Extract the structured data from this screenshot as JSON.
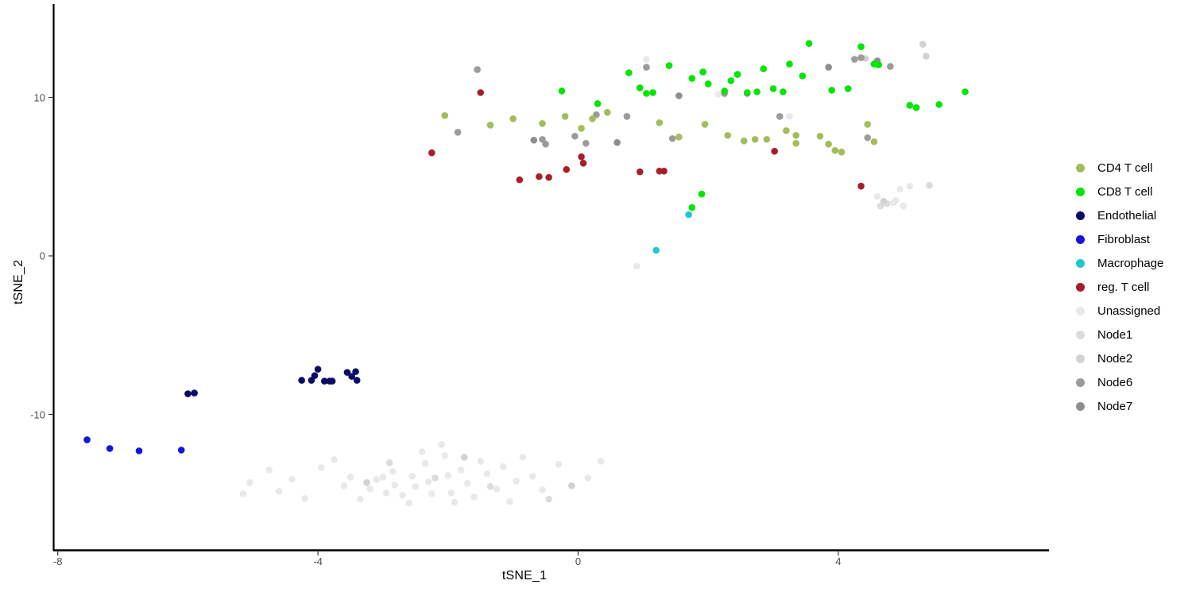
{
  "chart_data": {
    "type": "scatter",
    "title": "",
    "xlabel": "tSNE_1",
    "ylabel": "tSNE_2",
    "xlim": [
      -8.8,
      6.2
    ],
    "ylim": [
      -17.2,
      14.4
    ],
    "xticks": [
      -8,
      -4,
      0,
      4
    ],
    "xticklabels": [
      "-8",
      "-4",
      "0",
      "4"
    ],
    "yticks": [
      10,
      0,
      -10
    ],
    "yticklabels": [
      "10",
      "0",
      "-10"
    ],
    "grid": false,
    "legend_position": "right",
    "point_radius": 4.3,
    "series": [
      {
        "name": "CD4 T cell",
        "color": "#a3bd5a",
        "points": [
          [
            -2.05,
            8.85
          ],
          [
            -1.35,
            8.25
          ],
          [
            -1.0,
            8.65
          ],
          [
            -0.55,
            8.35
          ],
          [
            -0.2,
            8.8
          ],
          [
            0.05,
            8.05
          ],
          [
            0.22,
            8.65
          ],
          [
            0.45,
            9.05
          ],
          [
            1.25,
            8.4
          ],
          [
            1.55,
            7.5
          ],
          [
            1.95,
            8.3
          ],
          [
            2.3,
            7.6
          ],
          [
            2.55,
            7.25
          ],
          [
            2.72,
            7.35
          ],
          [
            2.9,
            7.35
          ],
          [
            3.2,
            7.9
          ],
          [
            3.35,
            7.6
          ],
          [
            3.35,
            7.1
          ],
          [
            3.72,
            7.55
          ],
          [
            3.85,
            7.05
          ],
          [
            3.95,
            6.65
          ],
          [
            4.05,
            6.55
          ],
          [
            4.45,
            8.3
          ],
          [
            4.55,
            7.2
          ]
        ]
      },
      {
        "name": "CD8 T cell",
        "color": "#00e600",
        "points": [
          [
            -0.25,
            10.4
          ],
          [
            0.3,
            9.6
          ],
          [
            0.78,
            11.55
          ],
          [
            0.95,
            10.6
          ],
          [
            1.05,
            10.25
          ],
          [
            1.4,
            12.0
          ],
          [
            1.75,
            11.2
          ],
          [
            1.92,
            11.6
          ],
          [
            2.0,
            10.85
          ],
          [
            2.25,
            10.4
          ],
          [
            2.35,
            11.05
          ],
          [
            2.45,
            11.45
          ],
          [
            2.6,
            10.3
          ],
          [
            2.85,
            11.8
          ],
          [
            3.0,
            10.55
          ],
          [
            3.15,
            10.35
          ],
          [
            3.45,
            11.35
          ],
          [
            3.55,
            13.4
          ],
          [
            3.9,
            10.45
          ],
          [
            4.15,
            10.55
          ],
          [
            4.35,
            13.2
          ],
          [
            4.55,
            12.1
          ],
          [
            4.62,
            12.05
          ],
          [
            5.1,
            9.5
          ],
          [
            5.2,
            9.35
          ],
          [
            5.55,
            9.55
          ],
          [
            5.95,
            10.35
          ],
          [
            1.9,
            3.9
          ],
          [
            1.75,
            3.05
          ],
          [
            2.75,
            10.35
          ],
          [
            3.25,
            12.1
          ],
          [
            1.15,
            10.3
          ]
        ]
      },
      {
        "name": "Endothelial",
        "color": "#0b0b66",
        "points": [
          [
            -6.0,
            -8.7
          ],
          [
            -5.9,
            -8.65
          ],
          [
            -4.25,
            -7.85
          ],
          [
            -4.1,
            -7.85
          ],
          [
            -4.0,
            -7.15
          ],
          [
            -4.05,
            -7.55
          ],
          [
            -3.9,
            -7.9
          ],
          [
            -3.82,
            -7.9
          ],
          [
            -3.78,
            -7.9
          ],
          [
            -3.55,
            -7.35
          ],
          [
            -3.48,
            -7.6
          ],
          [
            -3.4,
            -7.85
          ],
          [
            -3.42,
            -7.3
          ]
        ]
      },
      {
        "name": "Fibroblast",
        "color": "#1414dd",
        "points": [
          [
            -7.55,
            -11.6
          ],
          [
            -7.2,
            -12.15
          ],
          [
            -6.75,
            -12.3
          ],
          [
            -6.1,
            -12.25
          ]
        ]
      },
      {
        "name": "Macrophage",
        "color": "#1ec8cd",
        "points": [
          [
            1.7,
            2.6
          ],
          [
            1.2,
            0.35
          ]
        ]
      },
      {
        "name": "reg. T cell",
        "color": "#a61f28",
        "points": [
          [
            -2.25,
            6.5
          ],
          [
            -1.5,
            10.3
          ],
          [
            -0.9,
            4.8
          ],
          [
            -0.6,
            5.0
          ],
          [
            -0.45,
            4.95
          ],
          [
            -0.18,
            5.45
          ],
          [
            0.05,
            6.25
          ],
          [
            0.08,
            5.85
          ],
          [
            0.95,
            5.3
          ],
          [
            1.25,
            5.35
          ],
          [
            1.32,
            5.35
          ],
          [
            3.02,
            6.6
          ],
          [
            4.35,
            4.4
          ]
        ]
      },
      {
        "name": "Unassigned",
        "color": "#e9e9e9",
        "points": [
          [
            -3.95,
            -13.35
          ],
          [
            -3.6,
            -14.5
          ],
          [
            -3.5,
            -13.95
          ],
          [
            -3.35,
            -15.35
          ],
          [
            -3.2,
            -14.7
          ],
          [
            -3.1,
            -14.1
          ],
          [
            -3.0,
            -13.95
          ],
          [
            -2.95,
            -14.95
          ],
          [
            -2.85,
            -13.6
          ],
          [
            -2.82,
            -14.45
          ],
          [
            -2.7,
            -15.1
          ],
          [
            -2.55,
            -13.9
          ],
          [
            -2.5,
            -14.55
          ],
          [
            -2.4,
            -12.35
          ],
          [
            -2.35,
            -13.1
          ],
          [
            -2.3,
            -14.25
          ],
          [
            -2.25,
            -15.0
          ],
          [
            -2.1,
            -11.9
          ],
          [
            -2.05,
            -12.6
          ],
          [
            -2.0,
            -13.85
          ],
          [
            -1.95,
            -14.95
          ],
          [
            -1.8,
            -13.5
          ],
          [
            -1.7,
            -14.35
          ],
          [
            -1.6,
            -15.2
          ],
          [
            -1.5,
            -12.95
          ],
          [
            -1.4,
            -13.75
          ],
          [
            -1.25,
            -14.7
          ],
          [
            -1.15,
            -13.3
          ],
          [
            -0.95,
            -14.2
          ],
          [
            -0.85,
            -12.7
          ],
          [
            -0.7,
            -13.9
          ],
          [
            -0.55,
            -14.75
          ],
          [
            -4.4,
            -14.1
          ],
          [
            -4.6,
            -14.85
          ],
          [
            -4.75,
            -13.5
          ],
          [
            -5.05,
            -14.3
          ],
          [
            -5.15,
            -15.0
          ],
          [
            -4.2,
            -15.3
          ],
          [
            -0.3,
            -13.15
          ],
          [
            0.15,
            -14.0
          ],
          [
            0.35,
            -12.95
          ],
          [
            -1.05,
            -15.5
          ],
          [
            -1.9,
            -15.55
          ],
          [
            -2.6,
            -15.6
          ],
          [
            -3.75,
            -12.85
          ],
          [
            0.9,
            -0.65
          ],
          [
            4.6,
            3.75
          ],
          [
            5.1,
            4.4
          ],
          [
            4.95,
            4.2
          ],
          [
            4.85,
            3.35
          ],
          [
            4.88,
            3.5
          ],
          [
            5.0,
            3.15
          ],
          [
            1.05,
            12.4
          ],
          [
            2.15,
            10.2
          ],
          [
            2.25,
            10.2
          ],
          [
            3.25,
            8.8
          ]
        ]
      },
      {
        "name": "Node1",
        "color": "#dcdcdc",
        "points": [
          [
            -2.9,
            -13.05
          ],
          [
            -2.2,
            -14.0
          ],
          [
            -1.35,
            -14.55
          ],
          [
            -0.45,
            -15.35
          ],
          [
            4.75,
            3.3
          ],
          [
            4.65,
            3.15
          ],
          [
            5.4,
            4.45
          ]
        ]
      },
      {
        "name": "Node2",
        "color": "#d2d2d2",
        "points": [
          [
            -3.25,
            -14.3
          ],
          [
            -1.75,
            -12.7
          ],
          [
            -0.1,
            -14.5
          ],
          [
            4.7,
            3.45
          ],
          [
            5.35,
            12.6
          ],
          [
            5.3,
            13.35
          ],
          [
            4.42,
            12.45
          ]
        ]
      },
      {
        "name": "Node6",
        "color": "#9b9b9b",
        "points": [
          [
            -1.55,
            11.75
          ],
          [
            -1.85,
            7.8
          ],
          [
            -0.55,
            7.35
          ],
          [
            -0.5,
            7.05
          ],
          [
            -0.05,
            7.55
          ],
          [
            0.12,
            7.1
          ],
          [
            0.28,
            8.9
          ],
          [
            0.75,
            8.8
          ],
          [
            1.05,
            11.9
          ],
          [
            1.45,
            7.4
          ],
          [
            2.25,
            10.25
          ],
          [
            3.1,
            8.8
          ],
          [
            4.35,
            12.5
          ],
          [
            4.25,
            12.4
          ],
          [
            4.45,
            7.45
          ],
          [
            4.8,
            11.95
          ]
        ]
      },
      {
        "name": "Node7",
        "color": "#8e8e8e",
        "points": [
          [
            -0.68,
            7.3
          ],
          [
            0.6,
            7.15
          ],
          [
            1.55,
            10.1
          ],
          [
            2.6,
            10.25
          ],
          [
            3.85,
            11.9
          ],
          [
            4.6,
            12.3
          ]
        ]
      }
    ]
  },
  "axes": {
    "x_title": "tSNE_1",
    "y_title": "tSNE_2",
    "x_ticks": [
      "-8",
      "-4",
      "0",
      "4"
    ],
    "y_ticks": [
      "10",
      "0",
      "-10"
    ]
  },
  "legend": {
    "items": [
      {
        "label": "CD4 T cell",
        "color": "#a3bd5a"
      },
      {
        "label": "CD8 T cell",
        "color": "#00e600"
      },
      {
        "label": "Endothelial",
        "color": "#0b0b66"
      },
      {
        "label": "Fibroblast",
        "color": "#1414dd"
      },
      {
        "label": "Macrophage",
        "color": "#1ec8cd"
      },
      {
        "label": "reg. T cell",
        "color": "#a61f28"
      },
      {
        "label": "Unassigned",
        "color": "#e9e9e9"
      },
      {
        "label": "Node1",
        "color": "#dcdcdc"
      },
      {
        "label": "Node2",
        "color": "#d2d2d2"
      },
      {
        "label": "Node6",
        "color": "#9b9b9b"
      },
      {
        "label": "Node7",
        "color": "#8e8e8e"
      }
    ]
  }
}
